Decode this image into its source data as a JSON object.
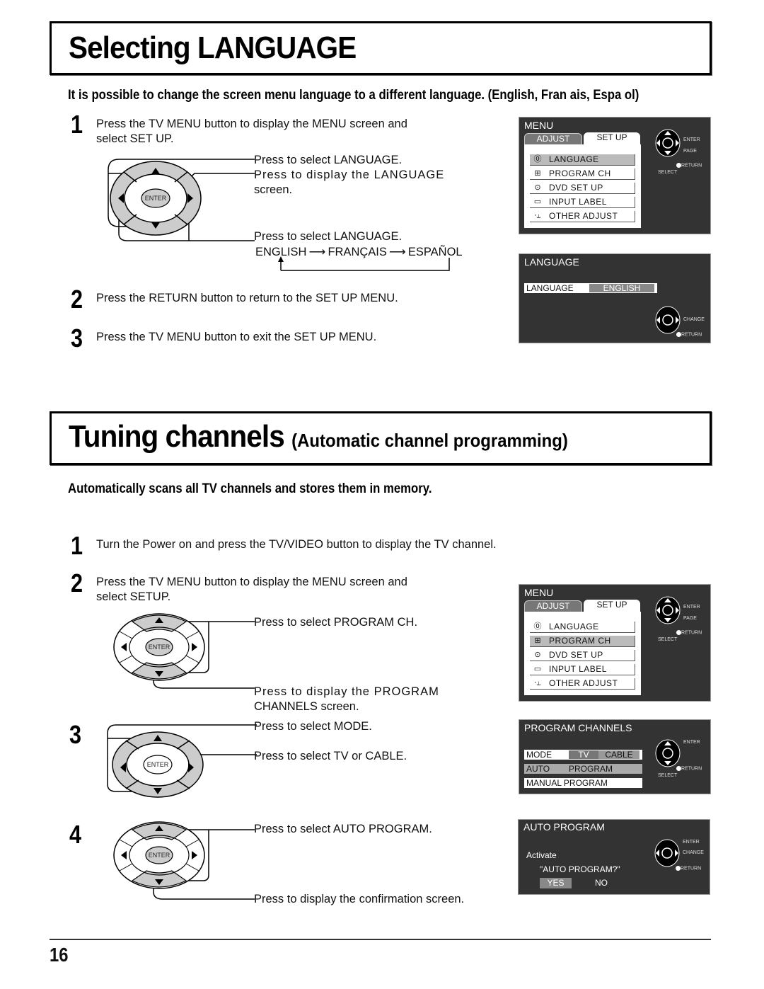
{
  "section1": {
    "title": "Selecting LANGUAGE",
    "intro": "It is possible to change the screen menu language to a different language. (English, Fran  ais, Espa  ol)",
    "steps": [
      {
        "num": "1",
        "text_line1": "Press the TV MENU button to display the MENU screen and",
        "text_line2": "select SET UP."
      },
      {
        "num": "2",
        "text": "Press the RETURN button to return to the SET UP MENU."
      },
      {
        "num": "3",
        "text": "Press the TV MENU button to exit the SET UP MENU."
      }
    ],
    "remote_notes": {
      "up_down": "Press to select LANGUAGE.",
      "enter_line1": "Press to display the LANGUAGE",
      "enter_line2": "screen.",
      "left_right": "Press to select LANGUAGE."
    },
    "language_cycle": [
      "ENGLISH",
      "FRANÇAIS",
      "ESPAÑOL"
    ],
    "menu_screen": {
      "header": "MENU",
      "tabs": [
        "ADJUST",
        "SET  UP"
      ],
      "items": [
        {
          "icon": "language-icon",
          "glyph": "⓪⟲",
          "label": "LANGUAGE",
          "selected": true
        },
        {
          "icon": "program-ch-icon",
          "glyph": "⊞",
          "label": "PROGRAM  CH",
          "selected": false
        },
        {
          "icon": "dvd-icon",
          "glyph": "⊙",
          "label": "DVD  SET  UP",
          "selected": false
        },
        {
          "icon": "input-label-icon",
          "glyph": "▭",
          "label": "INPUT  LABEL",
          "selected": false
        },
        {
          "icon": "other-adjust-icon",
          "glyph": "⸱⥿",
          "label": "OTHER  ADJUST",
          "selected": false
        }
      ],
      "pad_labels": {
        "enter": "ENTER",
        "page": "PAGE",
        "return": "RETURN",
        "select": "SELECT"
      }
    },
    "language_screen": {
      "header": "LANGUAGE",
      "row_label": "LANGUAGE",
      "row_value": "ENGLISH",
      "pad_labels": {
        "change": "CHANGE",
        "return": "RETURN"
      }
    }
  },
  "section2": {
    "title": "Tuning channels",
    "subtitle": "(Automatic channel programming)",
    "intro": "Automatically scans all TV channels and stores them in memory.",
    "steps": [
      {
        "num": "1",
        "text": "Turn the Power on and press the TV/VIDEO button to display the TV channel."
      },
      {
        "num": "2",
        "text_line1": "Press the TV MENU button to display the MENU screen and",
        "text_line2": "select SETUP."
      },
      {
        "num": "3"
      },
      {
        "num": "4"
      }
    ],
    "remote_notes": {
      "step2_up_down": "Press to select PROGRAM CH.",
      "step2_enter_line1": "Press to display the PROGRAM",
      "step2_enter_line2": "CHANNELS screen.",
      "step3_up_down": "Press to select MODE.",
      "step3_left_right": "Press to select TV or CABLE.",
      "step4_up_down": "Press to select AUTO PROGRAM.",
      "step4_enter": "Press to display the confirmation screen."
    },
    "menu_screen": {
      "header": "MENU",
      "tabs": [
        "ADJUST",
        "SET  UP"
      ],
      "items": [
        {
          "label": "LANGUAGE",
          "selected": false
        },
        {
          "label": "PROGRAM  CH",
          "selected": true
        },
        {
          "label": "DVD  SET  UP",
          "selected": false
        },
        {
          "label": "INPUT  LABEL",
          "selected": false
        },
        {
          "label": "OTHER  ADJUST",
          "selected": false
        }
      ],
      "pad_labels": {
        "enter": "ENTER",
        "page": "PAGE",
        "return": "RETURN",
        "select": "SELECT"
      }
    },
    "program_channels_screen": {
      "header": "PROGRAM CHANNELS",
      "mode_label": "MODE",
      "mode_options": [
        "TV",
        "CABLE"
      ],
      "auto_label": "AUTO",
      "auto_value": "PROGRAM",
      "manual_label": "MANUAL  PROGRAM",
      "pad_labels": {
        "enter": "ENTER",
        "return": "RETURN",
        "select": "SELECT"
      }
    },
    "auto_program_screen": {
      "header": "AUTO PROGRAM",
      "line1": "Activate",
      "line2": "\"AUTO PROGRAM?\"",
      "yes": "YES",
      "no": "NO",
      "pad_labels": {
        "enter": "ENTER",
        "change": "CHANGE",
        "return": "RETURN"
      }
    }
  },
  "remote": {
    "enter_label": "ENTER"
  },
  "footer": {
    "page_number": "16"
  }
}
